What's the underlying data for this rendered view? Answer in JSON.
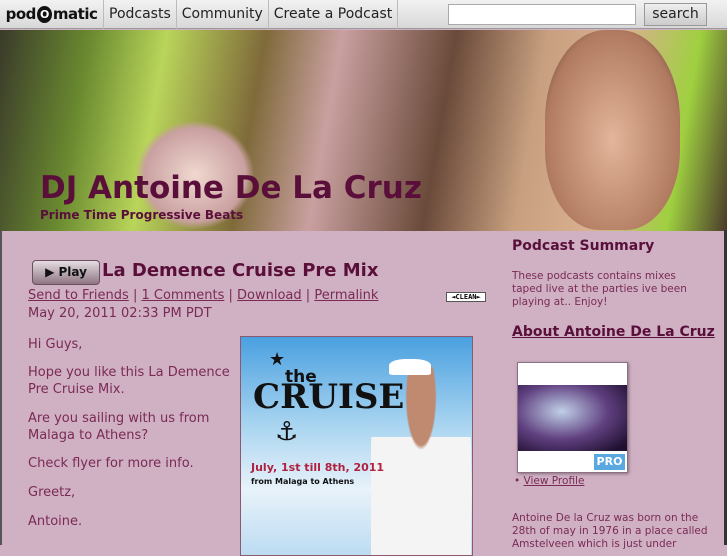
{
  "topbar": {
    "logo": "podomatic",
    "nav": [
      "Podcasts",
      "Community",
      "Create a Podcast"
    ],
    "search_value": "",
    "search_button": "search"
  },
  "banner": {
    "title": "DJ Antoine De La Cruz",
    "subtitle": "Prime Time Progressive Beats"
  },
  "episode": {
    "play_label": "Play",
    "title": "La Demence Cruise Pre Mix",
    "links": [
      "Send to Friends",
      "1 Comments",
      "Download",
      "Permalink"
    ],
    "separator": "|",
    "badge": "CLEAN",
    "date": "May 20, 2011 02:33 PM PDT",
    "paragraphs": [
      "Hi Guys,",
      "Hope you like this La Demence Pre Cruise Mix.",
      "Are you sailing with us from Malaga to Athens?",
      "Check flyer for more info.",
      "Greetz,",
      "Antoine."
    ],
    "flyer": {
      "the": "the",
      "cruise": "RUISE",
      "dates": "July, 1st till 8th, 2011",
      "from": "from Malaga to Athens"
    }
  },
  "sidebar": {
    "summary_heading": "Podcast Summary",
    "summary_text": "These podcasts contains mixes taped live at the parties ive been playing at.. Enjoy!",
    "about_heading": "About Antoine De La Cruz",
    "pro_badge": "PRO",
    "view_profile": "View Profile",
    "bio": "Antoine De la Cruz was born on the 28th of may in 1976 in a place called Amstelveen which is just under"
  }
}
